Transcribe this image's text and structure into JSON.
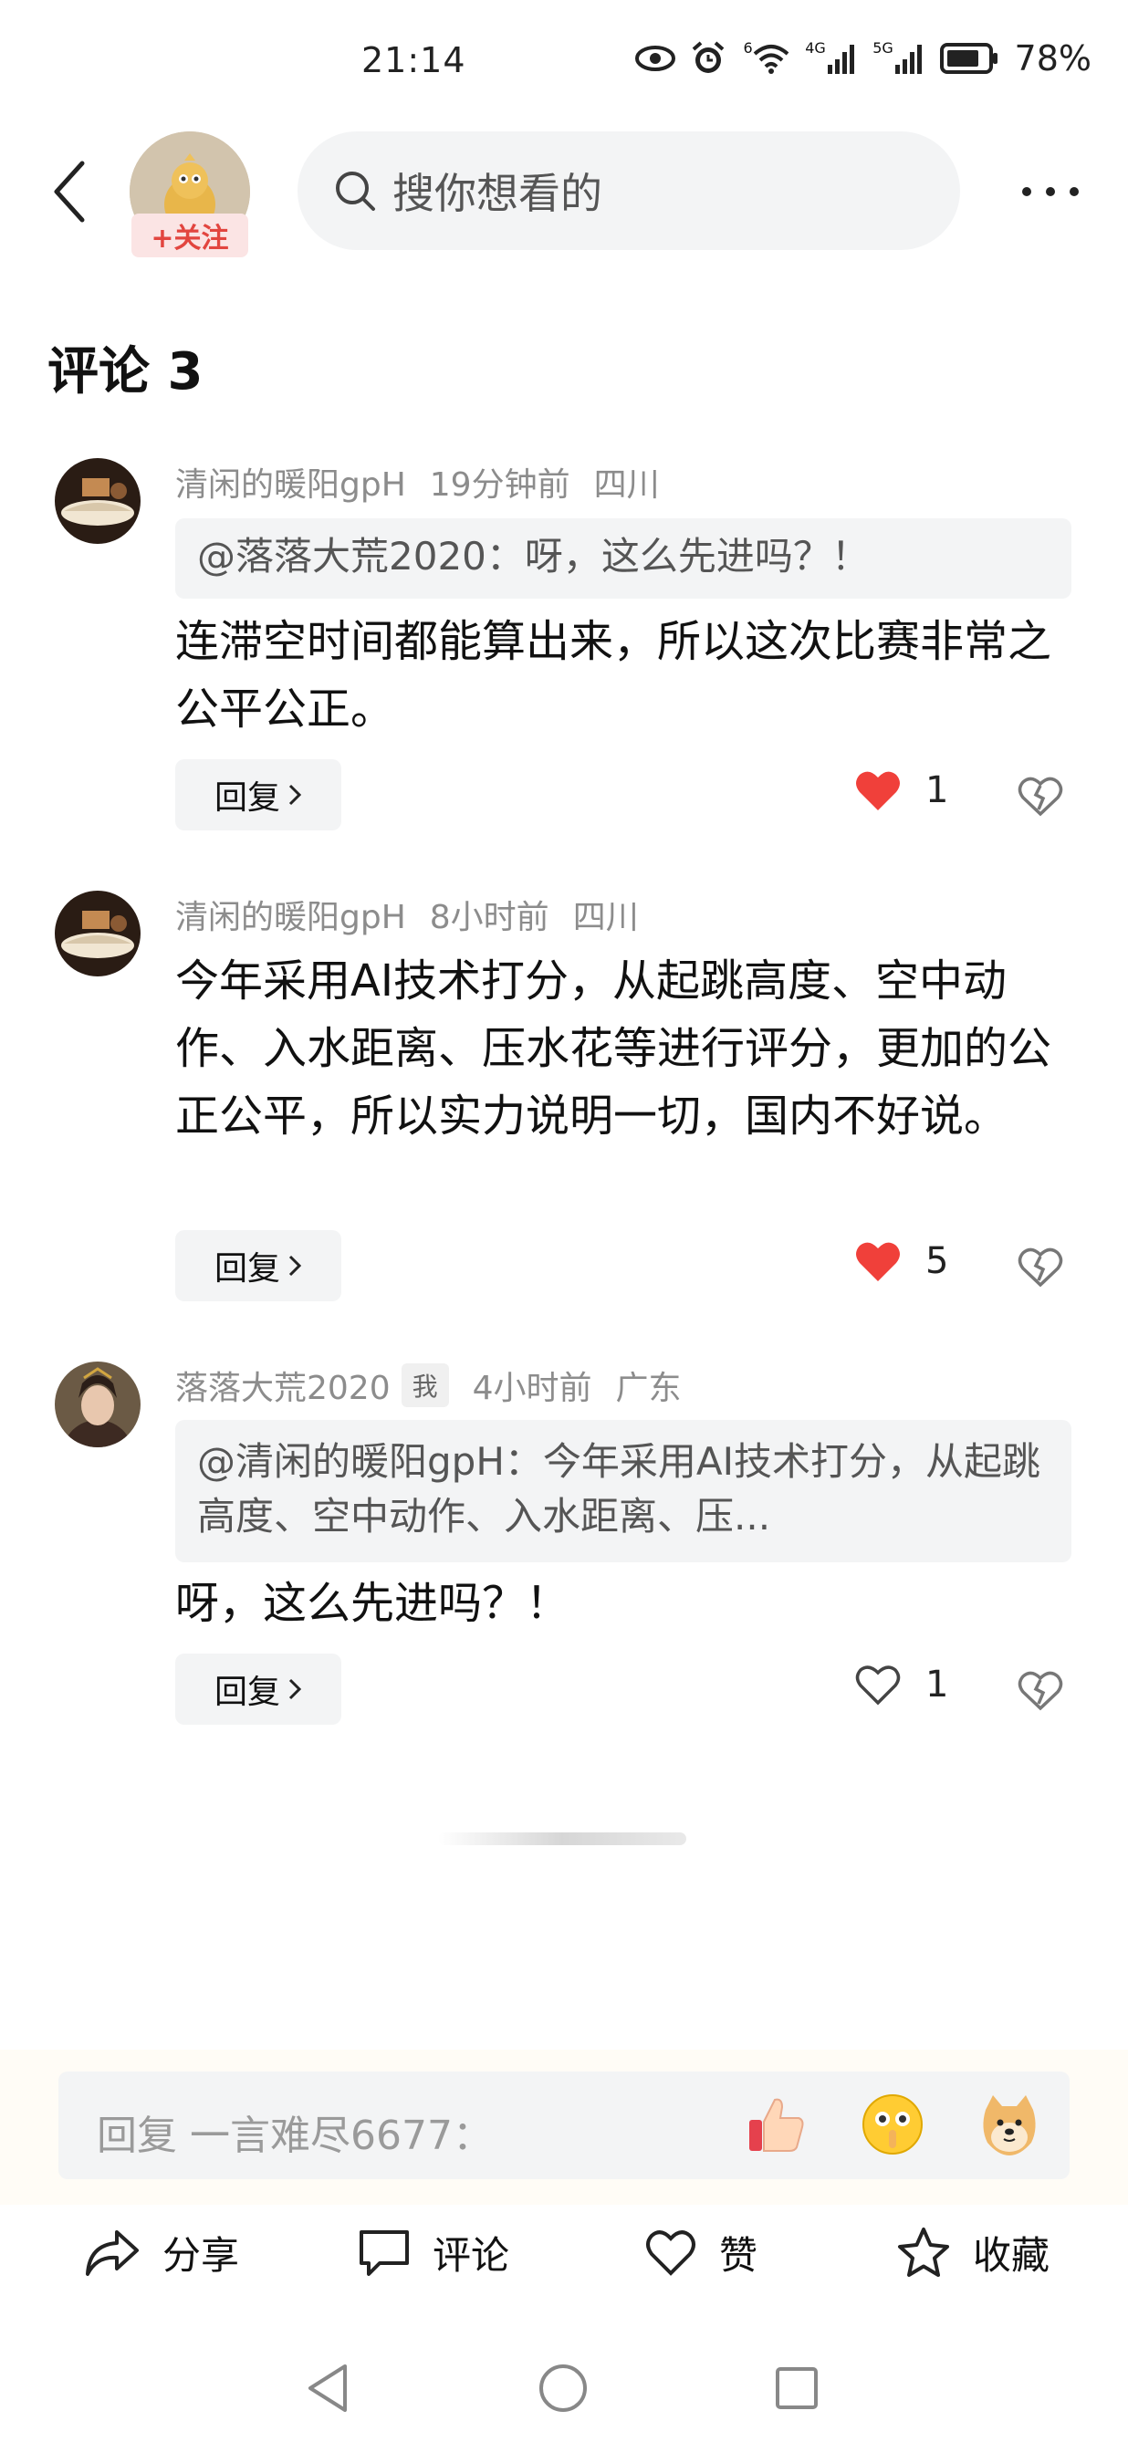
{
  "status_bar": {
    "time": "21:14",
    "network_1": "6",
    "network_2": "4G",
    "network_3": "5G",
    "battery": "78%",
    "icons": [
      "eye-icon",
      "alarm-icon",
      "wifi-icon",
      "signal-icon",
      "signal-icon",
      "battery-icon"
    ]
  },
  "header": {
    "follow_label": "+关注",
    "search_placeholder": "搜你想看的"
  },
  "comments_section": {
    "title": "评论 3"
  },
  "comments": [
    {
      "author": "清闲的暖阳gpH",
      "time": "19分钟前",
      "location": "四川",
      "quote": "@落落大荒2020：呀，这么先进吗？！",
      "text": "连滞空时间都能算出来，所以这次比赛非常之公平公正。",
      "reply_label": "回复",
      "likes": "1",
      "liked": true
    },
    {
      "author": "清闲的暖阳gpH",
      "time": "8小时前",
      "location": "四川",
      "text": "今年采用AI技术打分，从起跳高度、空中动作、入水距离、压水花等进行评分，更加的公正公平，所以实力说明一切，国内不好说。",
      "reply_label": "回复",
      "likes": "5",
      "liked": true
    },
    {
      "author": "落落大荒2020",
      "me_tag": "我",
      "time": "4小时前",
      "location": "广东",
      "quote": "@清闲的暖阳gpH：今年采用AI技术打分，从起跳高度、空中动作、入水距离、压...",
      "text": "呀，这么先进吗？！",
      "reply_label": "回复",
      "likes": "1",
      "liked": false
    }
  ],
  "reply_box": {
    "placeholder": "回复 一言难尽6677："
  },
  "actions": {
    "share": "分享",
    "comment": "评论",
    "like": "赞",
    "favorite": "收藏"
  },
  "colors": {
    "like_red": "#f0403a",
    "follow_red": "#e2453f",
    "muted_gray": "#8c8c8c",
    "pill_bg": "#f3f4f5"
  }
}
